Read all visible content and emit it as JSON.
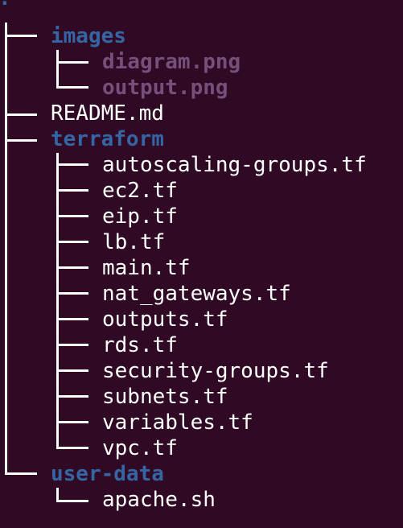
{
  "tree": {
    "root": ".",
    "images_dir": "images",
    "images_files": [
      "diagram.png",
      "output.png"
    ],
    "readme": "README.md",
    "terraform_dir": "terraform",
    "terraform_files": [
      "autoscaling-groups.tf",
      "ec2.tf",
      "eip.tf",
      "lb.tf",
      "main.tf",
      "nat_gateways.tf",
      "outputs.tf",
      "rds.tf",
      "security-groups.tf",
      "subnets.tf",
      "variables.tf",
      "vpc.tf"
    ],
    "user_data_dir": "user-data",
    "user_data_files": [
      "apache.sh"
    ]
  },
  "colors": {
    "background": "#300a24",
    "directory": "#3465a4",
    "image_file": "#75507b",
    "regular_file": "#ffffff"
  }
}
